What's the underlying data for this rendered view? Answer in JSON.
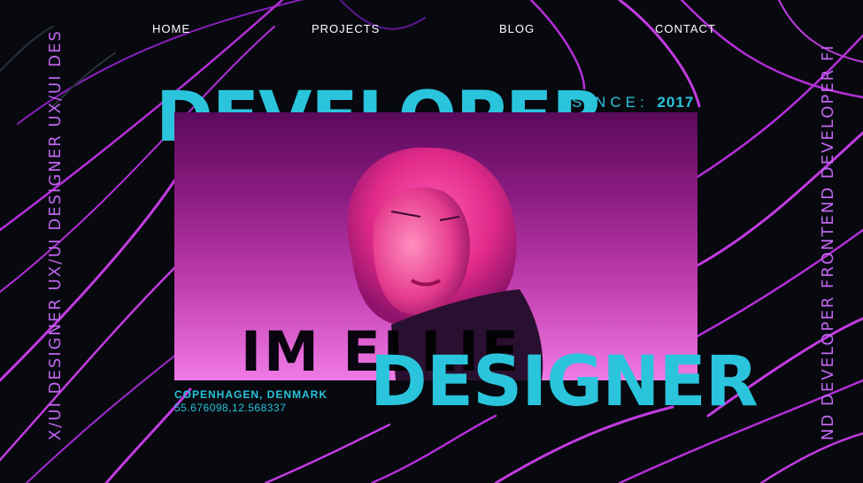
{
  "nav": {
    "home": "HOME",
    "projects": "PROJECTS",
    "blog": "BLOG",
    "contact": "CONTACT"
  },
  "hero": {
    "word_top": "DEVELOPER",
    "word_bottom": "DESIGNER",
    "since_label": "SINCE:",
    "since_year": "2017",
    "name": "IM ELLIE",
    "location": "COPENHAGEN, DENMARK",
    "coordinates": "55.676098,12.568337"
  },
  "side": {
    "left_text": "X/UI DESIGNER UX/UI DESIGNER UX/UI DES",
    "right_text": "ND DEVELOPER FRONTEND DEVELOPER FI"
  },
  "colors": {
    "background": "#07090f",
    "accent_cyan": "#2ac4dc",
    "line_magenta": "#b52fd8",
    "side_text": "#c266f0"
  },
  "icons": {
    "side_marker": "bracket-marker"
  }
}
